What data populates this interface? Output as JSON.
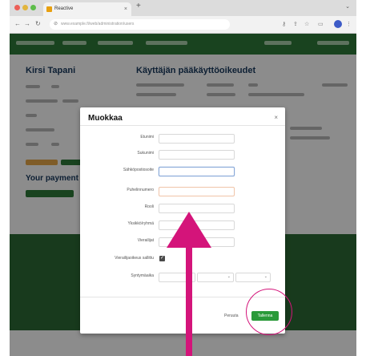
{
  "browser": {
    "tab_title": "Reactive",
    "tab_close": "×",
    "new_tab": "+",
    "url": "www.example.fi/web/administration/users"
  },
  "page": {
    "left_title": "Kirsi Tapani",
    "right_title": "Käyttäjän pääkäyttöoikeudet",
    "payment_title": "Your payment m"
  },
  "modal": {
    "title": "Muokkaa",
    "close": "×",
    "fields": [
      {
        "label": "Etunimi"
      },
      {
        "label": "Sukunimi"
      },
      {
        "label": "Sähköpostiosoite"
      },
      {
        "label": "Puhelinnumero"
      },
      {
        "label": "Rooli"
      },
      {
        "label": "Yksikkö/ryhmä"
      },
      {
        "label": "Vierailijat"
      }
    ],
    "checkbox_label": "Vierailijaoikeus sallittu",
    "checkbox_checked": true,
    "date_label": "Syntymäaika",
    "cancel_label": "Peruuta",
    "save_label": "Tallenna"
  },
  "annotation": {
    "arrow_color": "#d4147a",
    "circle_color": "#d4147a"
  },
  "colors": {
    "nav_green": "#2f7a3a",
    "save_green": "#2a9a3a"
  }
}
